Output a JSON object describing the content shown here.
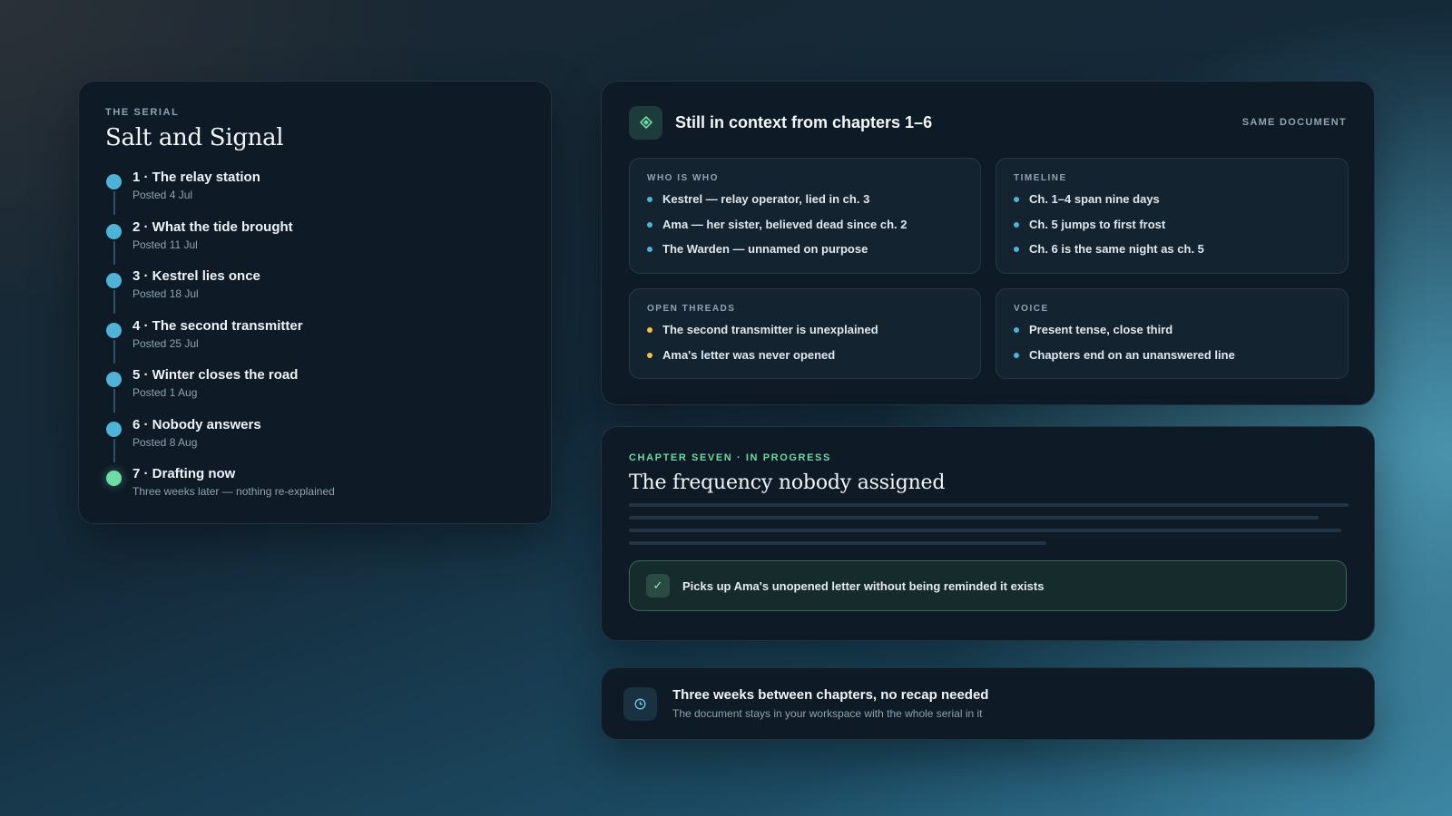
{
  "serial": {
    "eyebrow": "THE SERIAL",
    "title": "Salt and Signal",
    "chapters": [
      {
        "name": "1 · The relay station",
        "date": "Posted 4 Jul"
      },
      {
        "name": "2 · What the tide brought",
        "date": "Posted 11 Jul"
      },
      {
        "name": "3 · Kestrel lies once",
        "date": "Posted 18 Jul"
      },
      {
        "name": "4 · The second transmitter",
        "date": "Posted 25 Jul"
      },
      {
        "name": "5 · Winter closes the road",
        "date": "Posted 1 Aug"
      },
      {
        "name": "6 · Nobody answers",
        "date": "Posted 8 Aug"
      },
      {
        "name": "7 · Drafting now",
        "date": "Three weeks later — nothing re-explained"
      }
    ]
  },
  "context": {
    "icon": "diamond-icon",
    "title": "Still in context from chapters 1–6",
    "badge": "SAME DOCUMENT",
    "who": {
      "label": "WHO IS WHO",
      "items": [
        "Kestrel — relay operator, lied in ch. 3",
        "Ama — her sister, believed dead since ch. 2",
        "The Warden — unnamed on purpose"
      ]
    },
    "timeline": {
      "label": "TIMELINE",
      "items": [
        "Ch. 1–4 span nine days",
        "Ch. 5 jumps to first frost",
        "Ch. 6 is the same night as ch. 5"
      ]
    },
    "threads": {
      "label": "OPEN THREADS",
      "items": [
        "The second transmitter is unexplained",
        "Ama's letter was never opened"
      ]
    },
    "voice": {
      "label": "VOICE",
      "items": [
        "Present tense, close third",
        "Chapters end on an unanswered line"
      ]
    }
  },
  "draft": {
    "eyebrow": "CHAPTER SEVEN · IN PROGRESS",
    "title": "The frequency nobody assigned",
    "check_icon": "✓",
    "note": "Picks up Ama's unopened letter without being reminded it exists"
  },
  "banner": {
    "icon": "clock-icon",
    "title": "Three weeks between chapters, no recap needed",
    "subtitle": "The document stays in your workspace with the whole serial in it"
  },
  "colors": {
    "accent_blue": "#4fb3d8",
    "accent_green": "#6fdba6",
    "accent_amber": "#f2bf52",
    "card_bg": "#0e1a25"
  }
}
